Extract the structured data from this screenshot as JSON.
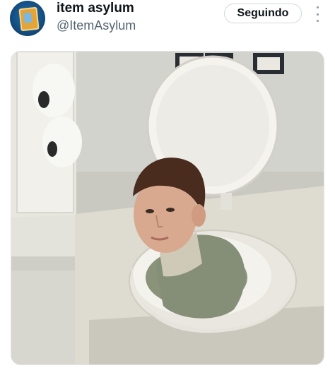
{
  "author": {
    "display_name": "item asylum",
    "handle": "@ItemAsylum",
    "avatar_icon": "item-card-avatar"
  },
  "actions": {
    "follow_label": "Seguindo",
    "more_icon": "more-vertical-icon"
  },
  "media": {
    "alt": "photo"
  },
  "colors": {
    "name": "#0f1419",
    "handle": "#536471",
    "border": "#cfd9de"
  }
}
